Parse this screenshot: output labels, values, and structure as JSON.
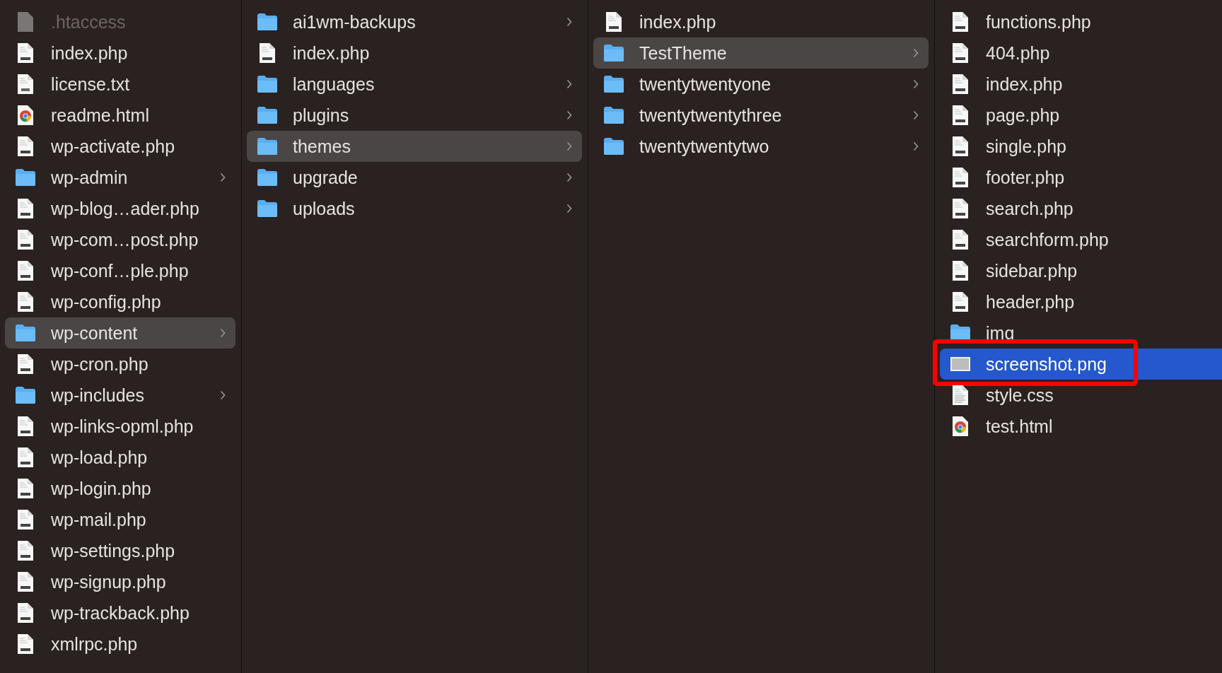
{
  "columns": [
    {
      "active": false,
      "items": [
        {
          "name": ".htaccess",
          "kind": "hidden",
          "selected": false,
          "outlined": false
        },
        {
          "name": "index.php",
          "kind": "php",
          "selected": false,
          "outlined": false
        },
        {
          "name": "license.txt",
          "kind": "txt",
          "selected": false,
          "outlined": false
        },
        {
          "name": "readme.html",
          "kind": "html",
          "selected": false,
          "outlined": false
        },
        {
          "name": "wp-activate.php",
          "kind": "php",
          "selected": false,
          "outlined": false
        },
        {
          "name": "wp-admin",
          "kind": "folder",
          "selected": false,
          "outlined": false
        },
        {
          "name": "wp-blog…ader.php",
          "kind": "php",
          "selected": false,
          "outlined": false
        },
        {
          "name": "wp-com…post.php",
          "kind": "php",
          "selected": false,
          "outlined": false
        },
        {
          "name": "wp-conf…ple.php",
          "kind": "php",
          "selected": false,
          "outlined": false
        },
        {
          "name": "wp-config.php",
          "kind": "php",
          "selected": false,
          "outlined": false
        },
        {
          "name": "wp-content",
          "kind": "folder",
          "selected": true,
          "outlined": false
        },
        {
          "name": "wp-cron.php",
          "kind": "php",
          "selected": false,
          "outlined": false
        },
        {
          "name": "wp-includes",
          "kind": "folder",
          "selected": false,
          "outlined": false
        },
        {
          "name": "wp-links-opml.php",
          "kind": "php",
          "selected": false,
          "outlined": false
        },
        {
          "name": "wp-load.php",
          "kind": "php",
          "selected": false,
          "outlined": false
        },
        {
          "name": "wp-login.php",
          "kind": "php",
          "selected": false,
          "outlined": false
        },
        {
          "name": "wp-mail.php",
          "kind": "php",
          "selected": false,
          "outlined": false
        },
        {
          "name": "wp-settings.php",
          "kind": "php",
          "selected": false,
          "outlined": false
        },
        {
          "name": "wp-signup.php",
          "kind": "php",
          "selected": false,
          "outlined": false
        },
        {
          "name": "wp-trackback.php",
          "kind": "php",
          "selected": false,
          "outlined": false
        },
        {
          "name": "xmlrpc.php",
          "kind": "php",
          "selected": false,
          "outlined": false
        }
      ]
    },
    {
      "active": false,
      "items": [
        {
          "name": "ai1wm-backups",
          "kind": "folder",
          "selected": false,
          "outlined": false
        },
        {
          "name": "index.php",
          "kind": "php",
          "selected": false,
          "outlined": false
        },
        {
          "name": "languages",
          "kind": "folder",
          "selected": false,
          "outlined": false
        },
        {
          "name": "plugins",
          "kind": "folder",
          "selected": false,
          "outlined": false
        },
        {
          "name": "themes",
          "kind": "folder",
          "selected": true,
          "outlined": false
        },
        {
          "name": "upgrade",
          "kind": "folder",
          "selected": false,
          "outlined": false
        },
        {
          "name": "uploads",
          "kind": "folder",
          "selected": false,
          "outlined": false
        }
      ]
    },
    {
      "active": false,
      "items": [
        {
          "name": "index.php",
          "kind": "php",
          "selected": false,
          "outlined": false
        },
        {
          "name": "TestTheme",
          "kind": "folder",
          "selected": true,
          "outlined": false
        },
        {
          "name": "twentytwentyone",
          "kind": "folder",
          "selected": false,
          "outlined": false
        },
        {
          "name": "twentytwentythree",
          "kind": "folder",
          "selected": false,
          "outlined": false
        },
        {
          "name": "twentytwentytwo",
          "kind": "folder",
          "selected": false,
          "outlined": false
        }
      ]
    },
    {
      "active": true,
      "items": [
        {
          "name": "functions.php",
          "kind": "php",
          "selected": false,
          "outlined": false
        },
        {
          "name": "404.php",
          "kind": "php",
          "selected": false,
          "outlined": false
        },
        {
          "name": "index.php",
          "kind": "php",
          "selected": false,
          "outlined": false
        },
        {
          "name": "page.php",
          "kind": "php",
          "selected": false,
          "outlined": false
        },
        {
          "name": "single.php",
          "kind": "php",
          "selected": false,
          "outlined": false
        },
        {
          "name": "footer.php",
          "kind": "php",
          "selected": false,
          "outlined": false
        },
        {
          "name": "search.php",
          "kind": "php",
          "selected": false,
          "outlined": false
        },
        {
          "name": "searchform.php",
          "kind": "php",
          "selected": false,
          "outlined": false
        },
        {
          "name": "sidebar.php",
          "kind": "php",
          "selected": false,
          "outlined": false
        },
        {
          "name": "header.php",
          "kind": "php",
          "selected": false,
          "outlined": false
        },
        {
          "name": "img",
          "kind": "folder",
          "selected": false,
          "outlined": false
        },
        {
          "name": "screenshot.png",
          "kind": "image",
          "selected": true,
          "outlined": true
        },
        {
          "name": "style.css",
          "kind": "css",
          "selected": false,
          "outlined": false
        },
        {
          "name": "test.html",
          "kind": "html",
          "selected": false,
          "outlined": false
        }
      ]
    }
  ]
}
